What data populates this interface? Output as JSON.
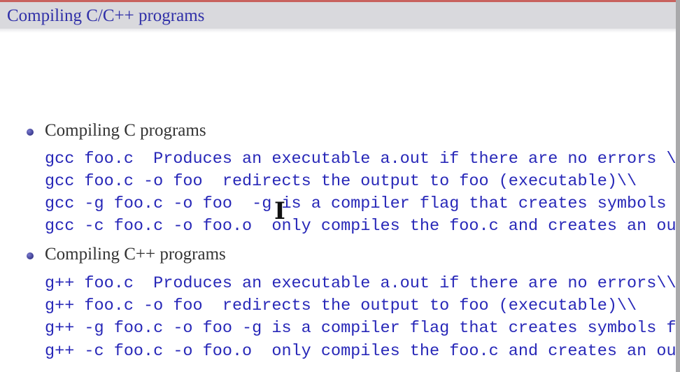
{
  "slide": {
    "title": "Compiling C/C++ programs",
    "sections": [
      {
        "heading": "Compiling C programs",
        "lines": [
          "gcc foo.c  Produces an executable a.out if there are no errors \\",
          "gcc foo.c -o foo  redirects the output to foo (executable)\\\\",
          "gcc -g foo.c -o foo  -g is a compiler flag that creates symbols",
          "gcc -c foo.c -o foo.o  only compiles the foo.c and creates an ou"
        ]
      },
      {
        "heading": "Compiling C++ programs",
        "lines": [
          "g++ foo.c  Produces an executable a.out if there are no errors\\\\",
          "g++ foo.c -o foo  redirects the output to foo (executable)\\\\",
          "g++ -g foo.c -o foo -g is a compiler flag that creates symbols f",
          "g++ -c foo.c -o foo.o  only compiles the foo.c and creates an ou"
        ]
      }
    ]
  },
  "colors": {
    "title": "#3030a8",
    "code": "#2828b8",
    "header_bg": "#d9d9dd",
    "accent_line": "#c8625e"
  },
  "cursor": {
    "icon": "text-cursor-icon"
  }
}
